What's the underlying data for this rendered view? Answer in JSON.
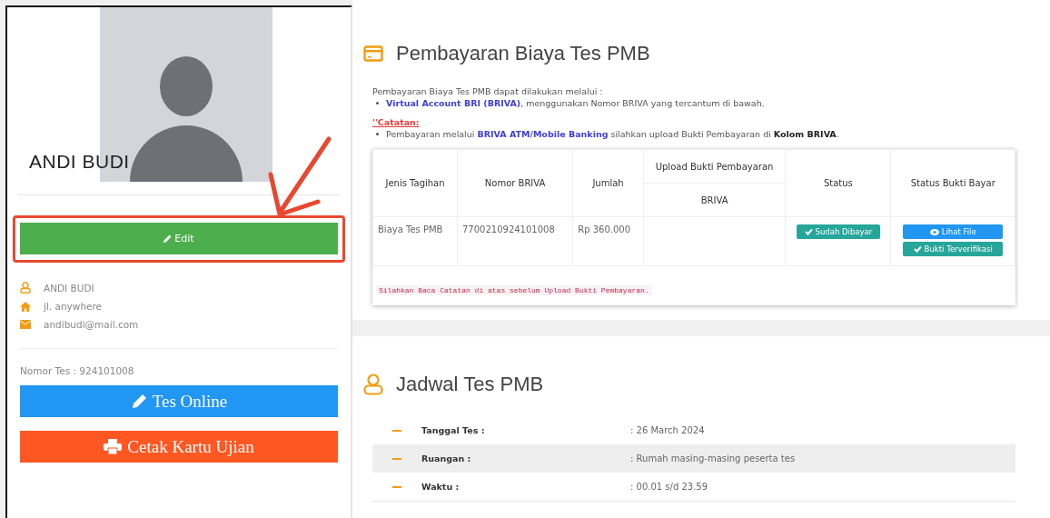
{
  "profile": {
    "name": "ANDI BUDI",
    "edit_button": "Edit",
    "info": [
      {
        "kind": "user",
        "text": "ANDI BUDI"
      },
      {
        "kind": "home",
        "text": "jl. anywhere"
      },
      {
        "kind": "mail",
        "text": "andibudi@mail.com"
      }
    ],
    "test_number": "Nomor Tes : 924101008",
    "buttons": [
      {
        "kind": "online",
        "label": "Tes Online"
      },
      {
        "kind": "print",
        "label": "Cetak Kartu Ujian"
      }
    ]
  },
  "payment": {
    "title": "Pembayaran Biaya Tes PMB",
    "intro": "Pembayaran Biaya Tes PMB dapat dilakukan melalui :",
    "bullets": [
      [
        {
          "kind": "link",
          "text": "Virtual Account BRI (BRIVA)"
        },
        {
          "kind": "plain",
          "text": ", menggunakan Nomor BRIVA yang tercantum di bawah."
        }
      ]
    ],
    "note_label": "''Catatan:",
    "note_bullets": [
      [
        {
          "kind": "plain",
          "text": "Pembayaran melalui "
        },
        {
          "kind": "link",
          "text": "BRIVA ATM/Mobile Banking"
        },
        {
          "kind": "plain",
          "text": " silahkan upload Bukti Pembayaran di "
        },
        {
          "kind": "bold",
          "text": "Kolom BRIVA"
        },
        {
          "kind": "plain",
          "text": "."
        }
      ]
    ],
    "table": {
      "columns": [
        "Jenis Tagihan",
        "Nomor BRIVA",
        "Jumlah",
        "Upload Bukti Pembayaran",
        "Status",
        "Status Bukti Bayar"
      ],
      "upload_sub": "BRIVA",
      "rows": [
        {
          "jenis": "Biaya Tes PMB",
          "nomor": "7700210924101008",
          "jumlah": "Rp 360.000",
          "status": "Sudah Dibayar",
          "file_button": "Lihat File",
          "proof_status": "Bukti Terverifikasi"
        }
      ],
      "note": "Silahkan Baca Catatan di atas sebelum Upload Bukti Pembayaran."
    }
  },
  "schedule": {
    "title": "Jadwal Tes PMB",
    "rows": [
      {
        "label": "Tanggal Tes :",
        "value": ": 26 March 2024"
      },
      {
        "label": "Ruangan :",
        "value": ": Rumah masing-masing peserta tes"
      },
      {
        "label": "Waktu :",
        "value": ": 00.01 s/d 23.59"
      }
    ]
  }
}
